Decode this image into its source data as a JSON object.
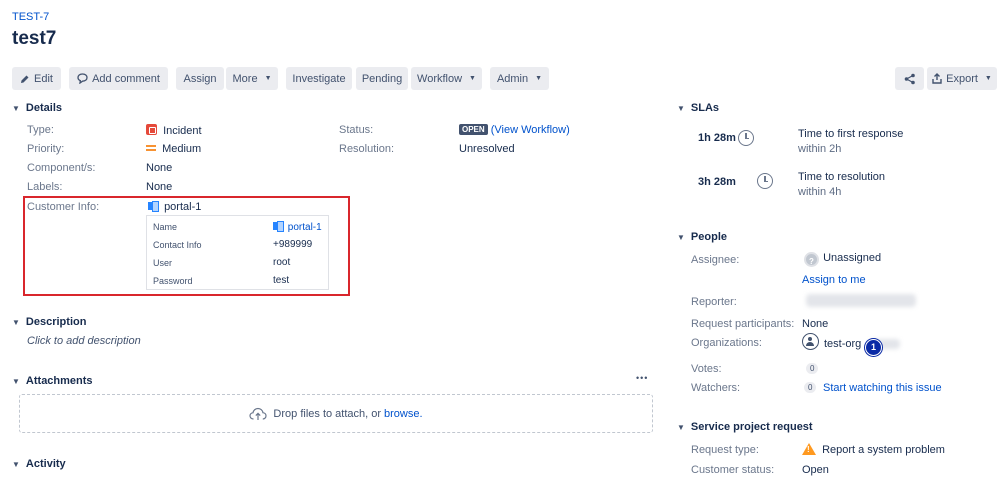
{
  "header": {
    "issue_key": "TEST-7",
    "title": "test7"
  },
  "toolbar": {
    "edit": "Edit",
    "add_comment": "Add comment",
    "assign": "Assign",
    "more": "More",
    "investigate": "Investigate",
    "pending": "Pending",
    "workflow": "Workflow",
    "admin": "Admin",
    "export": "Export"
  },
  "details": {
    "heading": "Details",
    "type_label": "Type:",
    "type_value": "Incident",
    "priority_label": "Priority:",
    "priority_value": "Medium",
    "components_label": "Component/s:",
    "components_value": "None",
    "labels_label": "Labels:",
    "labels_value": "None",
    "status_label": "Status:",
    "status_value": "OPEN",
    "status_link": "(View Workflow)",
    "resolution_label": "Resolution:",
    "resolution_value": "Unresolved",
    "customer_info_label": "Customer Info:",
    "customer": {
      "title": "portal-1",
      "rows": [
        {
          "label": "Name",
          "value": "portal-1"
        },
        {
          "label": "Contact Info",
          "value": "+989999"
        },
        {
          "label": "User",
          "value": "root"
        },
        {
          "label": "Password",
          "value": "test"
        }
      ]
    }
  },
  "description": {
    "heading": "Description",
    "placeholder": "Click to add description"
  },
  "attachments": {
    "heading": "Attachments",
    "more": "•••",
    "drop_text": "Drop files to attach, or",
    "browse": "browse."
  },
  "activity": {
    "heading": "Activity"
  },
  "slas": {
    "heading": "SLAs",
    "items": [
      {
        "time": "1h 28m",
        "name": "Time to first response",
        "goal": "within 2h"
      },
      {
        "time": "3h 28m",
        "name": "Time to resolution",
        "goal": "within 4h"
      }
    ]
  },
  "people": {
    "heading": "People",
    "assignee_label": "Assignee:",
    "assignee_value": "Unassigned",
    "assign_to_me": "Assign to me",
    "reporter_label": "Reporter:",
    "participants_label": "Request participants:",
    "participants_value": "None",
    "organizations_label": "Organizations:",
    "organizations_value": "test-org",
    "badge": "1",
    "votes_label": "Votes:",
    "votes_count": "0",
    "watchers_label": "Watchers:",
    "watchers_count": "0",
    "watch_link": "Start watching this issue"
  },
  "service_request": {
    "heading": "Service project request",
    "type_label": "Request type:",
    "type_value": "Report a system problem",
    "status_label": "Customer status:",
    "status_value": "Open"
  },
  "colors": {
    "link": "#0052cc",
    "highlight": "#d9262c",
    "badge": "#0a2aa6"
  }
}
